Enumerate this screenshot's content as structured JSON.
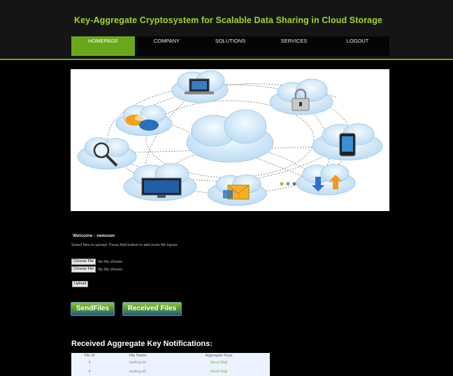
{
  "header": {
    "title": "Key-Aggregate Cryptosystem for Scalable Data Sharing in Cloud Storage"
  },
  "nav": {
    "items": [
      {
        "label": "HOMEPAGE"
      },
      {
        "label": "COMPANY"
      },
      {
        "label": "SOLUTIONS"
      },
      {
        "label": "SERVICES"
      },
      {
        "label": "LOGOUT"
      }
    ]
  },
  "colors": {
    "accent_green": "#6aa71d",
    "title_green": "#9fd62a",
    "background": "#000000",
    "cloud_blue": "#cfe6f7"
  },
  "banner": {
    "icons": [
      "laptop-icon",
      "lock-icon",
      "chat-bubbles-icon",
      "magnifier-icon",
      "tablet-icon",
      "monitor-icon",
      "envelope-icon",
      "download-upload-icon"
    ]
  },
  "upload": {
    "welcome": "Welcome : newuser",
    "instructions": "Select files to upload. Press Add button to add more file inputs.",
    "choose_file_label": "Choose File",
    "no_file_text": "No file chosen",
    "upload_label": "Upload"
  },
  "buttons": {
    "send_files": "SendFiles",
    "received_files": "Received Files"
  },
  "notifications": {
    "title": "Received Aggregate Key Notifications:",
    "columns": [
      "File Id",
      "File Name",
      "Aggregate Keys"
    ],
    "rows": [
      [
        "4",
        "testing.txt",
        "Send Mail"
      ],
      [
        "4",
        "testing.txt",
        "Send Mail"
      ]
    ]
  }
}
